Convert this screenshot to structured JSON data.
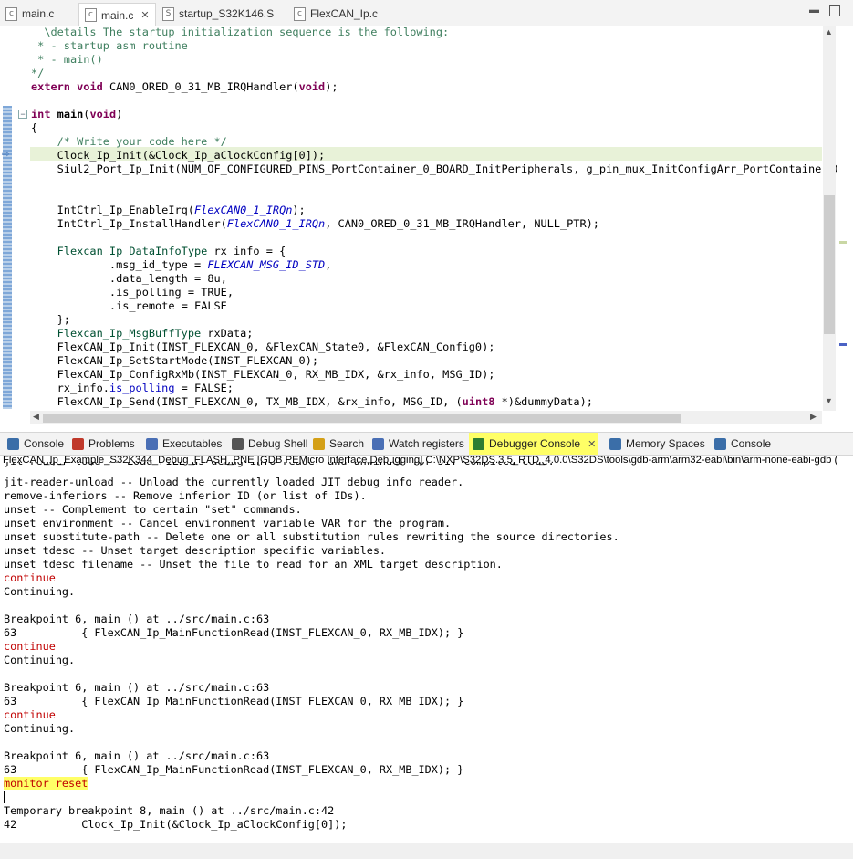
{
  "editor_tabs": [
    {
      "label": "main.c",
      "icon": "c-file-icon"
    },
    {
      "label": "main.c",
      "icon": "c-file-icon"
    },
    {
      "label": "startup_S32K146.S",
      "icon": "s-file-icon"
    },
    {
      "label": "FlexCAN_Ip.c",
      "icon": "c-file-icon"
    }
  ],
  "editor": {
    "lines": [
      "  \\details The startup initialization sequence is the following:",
      " * - startup asm routine",
      " * - main()",
      "*/",
      "extern void CAN0_ORED_0_31_MB_IRQHandler(void);",
      "",
      "int main(void)",
      "{",
      "    /* Write your code here */",
      "    Clock_Ip_Init(&Clock_Ip_aClockConfig[0]);",
      "    Siul2_Port_Ip_Init(NUM_OF_CONFIGURED_PINS_PortContainer_0_BOARD_InitPeripherals, g_pin_mux_InitConfigArr_PortContainer_0",
      "",
      "",
      "    IntCtrl_Ip_EnableIrq(FlexCAN0_1_IRQn);",
      "    IntCtrl_Ip_InstallHandler(FlexCAN0_1_IRQn, CAN0_ORED_0_31_MB_IRQHandler, NULL_PTR);",
      "",
      "    Flexcan_Ip_DataInfoType rx_info = {",
      "            .msg_id_type = FLEXCAN_MSG_ID_STD,",
      "            .data_length = 8u,",
      "            .is_polling = TRUE,",
      "            .is_remote = FALSE",
      "    };",
      "    Flexcan_Ip_MsgBuffType rxData;",
      "    FlexCAN_Ip_Init(INST_FLEXCAN_0, &FlexCAN_State0, &FlexCAN_Config0);",
      "    FlexCAN_Ip_SetStartMode(INST_FLEXCAN_0);",
      "    FlexCAN_Ip_ConfigRxMb(INST_FLEXCAN_0, RX_MB_IDX, &rx_info, MSG_ID);",
      "    rx_info.is_polling = FALSE;",
      "    FlexCAN_Ip_Send(INST_FLEXCAN_0, TX_MB_IDX, &rx_info, MSG_ID, (uint8 *)&dummyData);"
    ]
  },
  "view_tabs": [
    {
      "label": "Console",
      "icon": "console-icon",
      "color": "#3b6ea8"
    },
    {
      "label": "Problems",
      "icon": "problems-icon",
      "color": "#c0392b"
    },
    {
      "label": "Executables",
      "icon": "executables-icon",
      "color": "#4a6fb5"
    },
    {
      "label": "Debug Shell",
      "icon": "debug-shell-icon",
      "color": "#555555"
    },
    {
      "label": "Search",
      "icon": "search-icon",
      "color": "#d4a017"
    },
    {
      "label": "Watch registers",
      "icon": "watch-registers-icon",
      "color": "#4a6fb5"
    },
    {
      "label": "Debugger Console",
      "icon": "debugger-console-icon",
      "color": "#2e7d32"
    },
    {
      "label": "Memory Spaces",
      "icon": "memory-spaces-icon",
      "color": "#3b6ea8"
    },
    {
      "label": "Console",
      "icon": "console-icon",
      "color": "#3b6ea8"
    }
  ],
  "console": {
    "title": "FlexCAN_Ip_Example_S32K344_Debug_FLASH_PNE [GDB PEMicro Interface Debugging] C:\\NXP\\S32DS.3.5_RTD_4.0.0\\S32DS\\tools\\gdb-arm\\arm32-eabi\\bin\\arm-none-eabi-gdb (",
    "lines": [
      {
        "text": "jit-reader-load -- Load FILE as debug info reader and unwinder for JIT compiled code.",
        "style": "normal"
      },
      {
        "text": "jit-reader-unload -- Unload the currently loaded JIT debug info reader.",
        "style": "normal"
      },
      {
        "text": "remove-inferiors -- Remove inferior ID (or list of IDs).",
        "style": "normal"
      },
      {
        "text": "unset -- Complement to certain \"set\" commands.",
        "style": "normal"
      },
      {
        "text": "unset environment -- Cancel environment variable VAR for the program.",
        "style": "normal"
      },
      {
        "text": "unset substitute-path -- Delete one or all substitution rules rewriting the source directories.",
        "style": "normal"
      },
      {
        "text": "unset tdesc -- Unset target description specific variables.",
        "style": "normal"
      },
      {
        "text": "unset tdesc filename -- Unset the file to read for an XML target description.",
        "style": "normal"
      },
      {
        "text": "continue",
        "style": "red"
      },
      {
        "text": "Continuing.",
        "style": "normal"
      },
      {
        "text": "",
        "style": "normal"
      },
      {
        "text": "Breakpoint 6, main () at ../src/main.c:63",
        "style": "normal"
      },
      {
        "text": "63          { FlexCAN_Ip_MainFunctionRead(INST_FLEXCAN_0, RX_MB_IDX); }",
        "style": "normal"
      },
      {
        "text": "continue",
        "style": "red"
      },
      {
        "text": "Continuing.",
        "style": "normal"
      },
      {
        "text": "",
        "style": "normal"
      },
      {
        "text": "Breakpoint 6, main () at ../src/main.c:63",
        "style": "normal"
      },
      {
        "text": "63          { FlexCAN_Ip_MainFunctionRead(INST_FLEXCAN_0, RX_MB_IDX); }",
        "style": "normal"
      },
      {
        "text": "continue",
        "style": "red"
      },
      {
        "text": "Continuing.",
        "style": "normal"
      },
      {
        "text": "",
        "style": "normal"
      },
      {
        "text": "Breakpoint 6, main () at ../src/main.c:63",
        "style": "normal"
      },
      {
        "text": "63          { FlexCAN_Ip_MainFunctionRead(INST_FLEXCAN_0, RX_MB_IDX); }",
        "style": "normal"
      },
      {
        "text": "monitor reset",
        "style": "highlight"
      },
      {
        "text": "",
        "style": "normal"
      },
      {
        "text": "Temporary breakpoint 8, main () at ../src/main.c:42",
        "style": "normal"
      },
      {
        "text": "42          Clock_Ip_Init(&Clock_Ip_aClockConfig[0]);",
        "style": "normal"
      }
    ]
  }
}
